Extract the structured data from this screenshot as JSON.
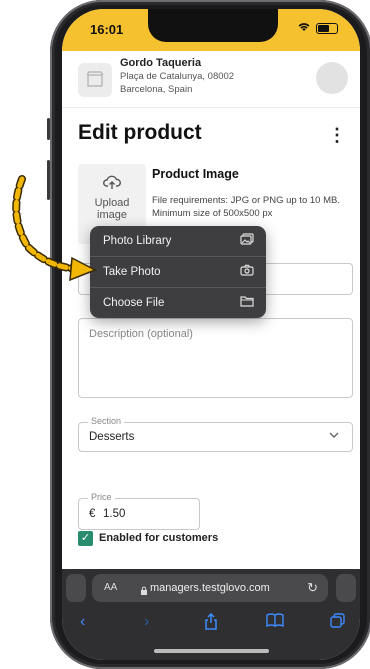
{
  "status": {
    "time": "16:01"
  },
  "store": {
    "name": "Gordo Taqueria",
    "address_line1": "Plaça de Catalunya, 08002",
    "address_line2": "Barcelona, Spain"
  },
  "page": {
    "title": "Edit product",
    "more": "⋮"
  },
  "image_section": {
    "upload_line1": "Upload",
    "upload_line2": "image",
    "title": "Product Image",
    "requirements": "File requirements: JPG or PNG up to 10 MB. Minimum size of 500x500 px"
  },
  "menu": {
    "items": [
      {
        "label": "Photo Library",
        "icon": "photo-library-icon"
      },
      {
        "label": "Take Photo",
        "icon": "camera-icon"
      },
      {
        "label": "Choose File",
        "icon": "folder-icon"
      }
    ]
  },
  "description": {
    "placeholder": "Description (optional)"
  },
  "section": {
    "legend": "Section",
    "value": "Desserts"
  },
  "price": {
    "legend": "Price",
    "currency": "€",
    "value": "1.50"
  },
  "enabled": {
    "label": "Enabled for customers",
    "checked": true
  },
  "browser": {
    "aa": "AA",
    "url": "managers.testglovo.com"
  },
  "colors": {
    "brand_yellow": "#f6c12f",
    "check_green": "#2a8c6f",
    "arrow_yellow": "#f2b705"
  }
}
